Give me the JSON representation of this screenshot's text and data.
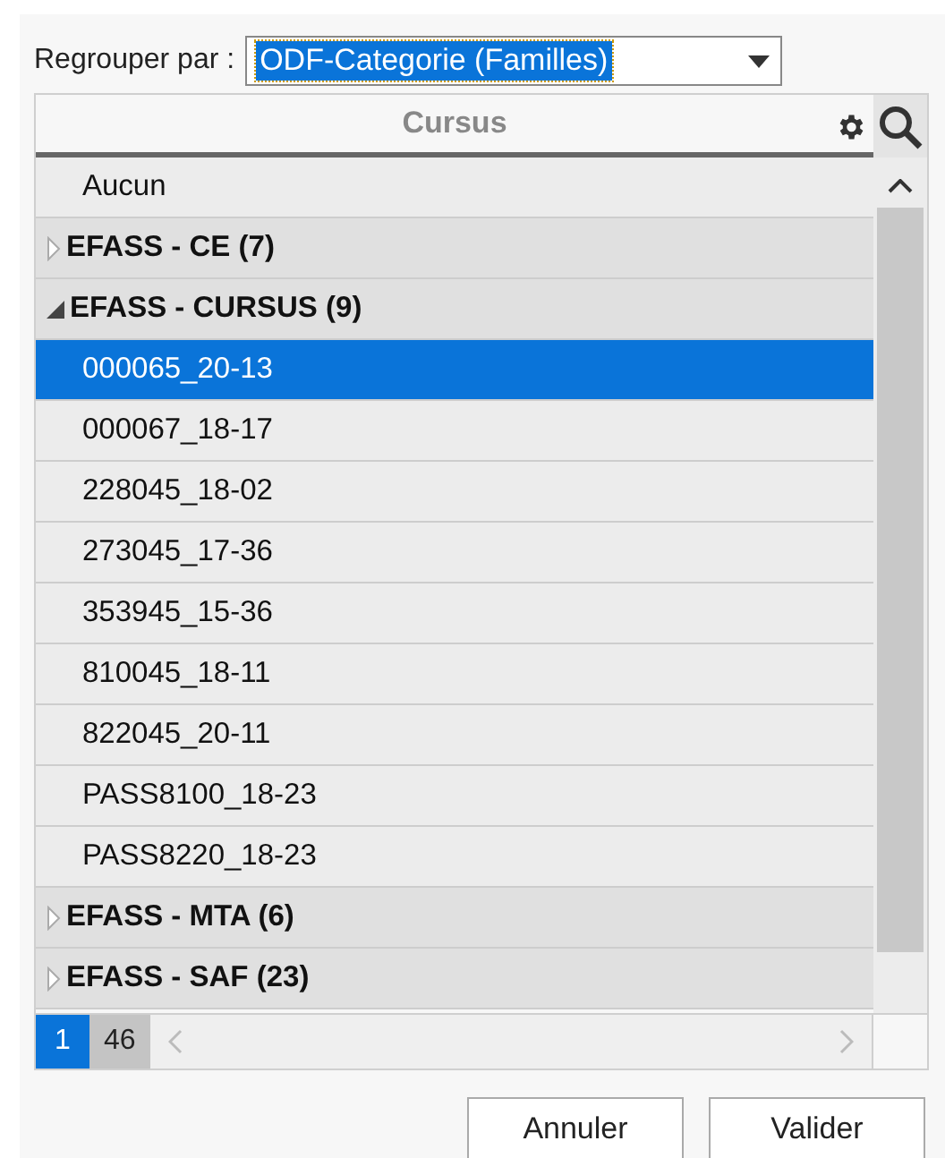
{
  "group_by": {
    "label": "Regrouper par :",
    "value": "ODF-Categorie (Familles)"
  },
  "grid": {
    "column": "Cursus",
    "rows": [
      {
        "kind": "none",
        "label": "Aucun"
      },
      {
        "kind": "group",
        "label": "EFASS - CE (7)",
        "expanded": false
      },
      {
        "kind": "group",
        "label": "EFASS - CURSUS (9)",
        "expanded": true,
        "children": [
          {
            "label": "000065_20-13",
            "selected": true
          },
          {
            "label": "000067_18-17",
            "selected": false
          },
          {
            "label": "228045_18-02",
            "selected": false
          },
          {
            "label": "273045_17-36",
            "selected": false
          },
          {
            "label": "353945_15-36",
            "selected": false
          },
          {
            "label": "810045_18-11",
            "selected": false
          },
          {
            "label": "822045_20-11",
            "selected": false
          },
          {
            "label": "PASS8100_18-23",
            "selected": false
          },
          {
            "label": "PASS8220_18-23",
            "selected": false
          }
        ]
      },
      {
        "kind": "group",
        "label": "EFASS - MTA (6)",
        "expanded": false
      },
      {
        "kind": "group",
        "label": "EFASS - SAF (23)",
        "expanded": false
      }
    ],
    "pages": [
      {
        "label": "1",
        "selected": true
      },
      {
        "label": "46",
        "selected": false
      }
    ]
  },
  "buttons": [
    "Annuler",
    "Valider"
  ]
}
